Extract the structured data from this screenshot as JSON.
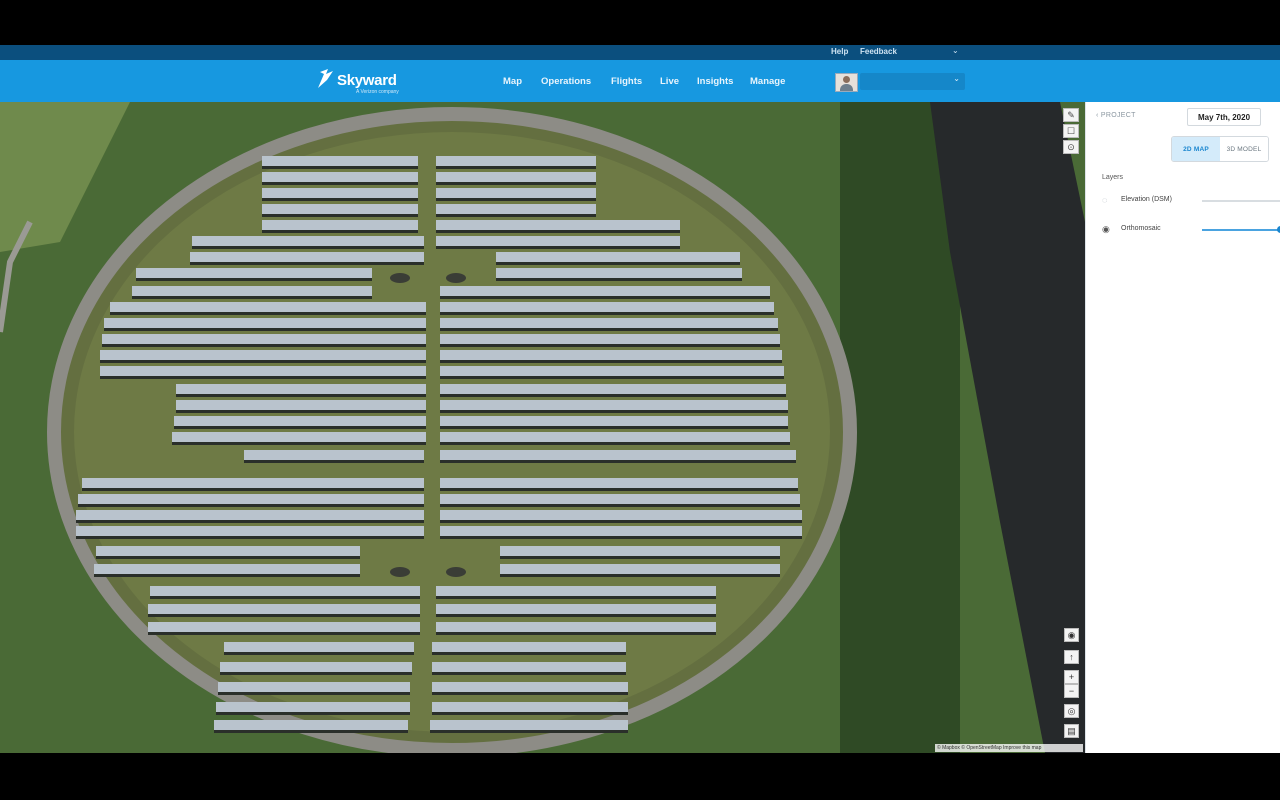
{
  "utility_bar": {
    "help": "Help",
    "feedback": "Feedback"
  },
  "brand": {
    "name": "Skyward",
    "tagline": "A Verizon company"
  },
  "nav": [
    {
      "label": "Map"
    },
    {
      "label": "Operations"
    },
    {
      "label": "Flights"
    },
    {
      "label": "Live"
    },
    {
      "label": "Insights"
    },
    {
      "label": "Manage"
    }
  ],
  "user": {
    "account_value": ""
  },
  "panel": {
    "back_label": "‹ PROJECT",
    "date": "May 7th, 2020",
    "view_toggle": {
      "map_2d": "2D MAP",
      "model_3d": "3D MODEL",
      "active": "2D MAP"
    },
    "layers_title": "Layers",
    "layers": [
      {
        "name": "Elevation (DSM)",
        "visible": false
      },
      {
        "name": "Orthomosaic",
        "visible": true,
        "opacity_pct": 100
      }
    ]
  },
  "map": {
    "attribution": "© Mapbox © OpenStreetMap Improve this map",
    "colors": {
      "grass": "#6b7a44",
      "panel": "#b9c3cd",
      "road": "#8a8b86",
      "trees": "#3e5e2e",
      "water": "#2a2e30"
    }
  }
}
